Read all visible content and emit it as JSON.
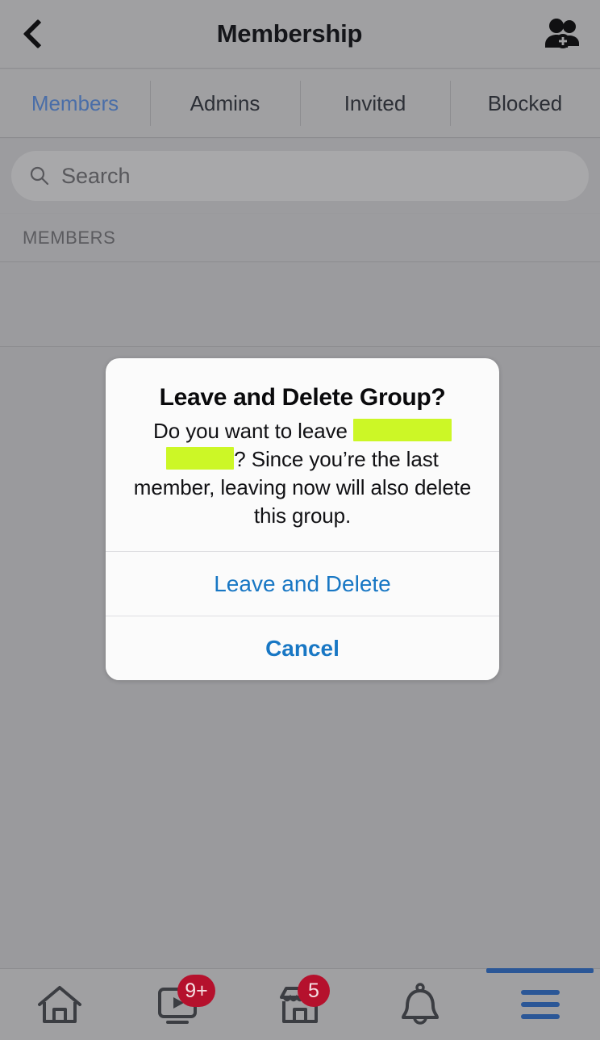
{
  "header": {
    "back_icon": "chevron-left-icon",
    "title": "Membership",
    "action_icon": "add-members-icon"
  },
  "tabs": [
    {
      "label": "Members",
      "active": true
    },
    {
      "label": "Admins",
      "active": false
    },
    {
      "label": "Invited",
      "active": false
    },
    {
      "label": "Blocked",
      "active": false
    }
  ],
  "search": {
    "icon": "search-icon",
    "placeholder": "Search",
    "value": ""
  },
  "list": {
    "section_header": "MEMBERS"
  },
  "dialog": {
    "title": "Leave and Delete Group?",
    "message_part1": "Do you want to leave",
    "redacted_1": "",
    "redacted_2": "",
    "message_part2": "? Since you’re the last member, leaving now will also delete this group.",
    "primary_label": "Leave and Delete",
    "cancel_label": "Cancel",
    "redaction_color": "#ccf726",
    "link_color": "#1877c4"
  },
  "bottom_nav": [
    {
      "icon": "home-icon",
      "badge": "",
      "active": false
    },
    {
      "icon": "video-icon",
      "badge": "9+",
      "active": false
    },
    {
      "icon": "marketplace-icon",
      "badge": "5",
      "active": false
    },
    {
      "icon": "bell-icon",
      "badge": "",
      "active": false
    },
    {
      "icon": "menu-icon",
      "badge": "",
      "active": true
    }
  ],
  "colors": {
    "dim_overlay": "#9a9a9d",
    "badge_red": "#b5112d",
    "active_blue": "#2b5797",
    "tab_active": "#4a6ea8"
  }
}
